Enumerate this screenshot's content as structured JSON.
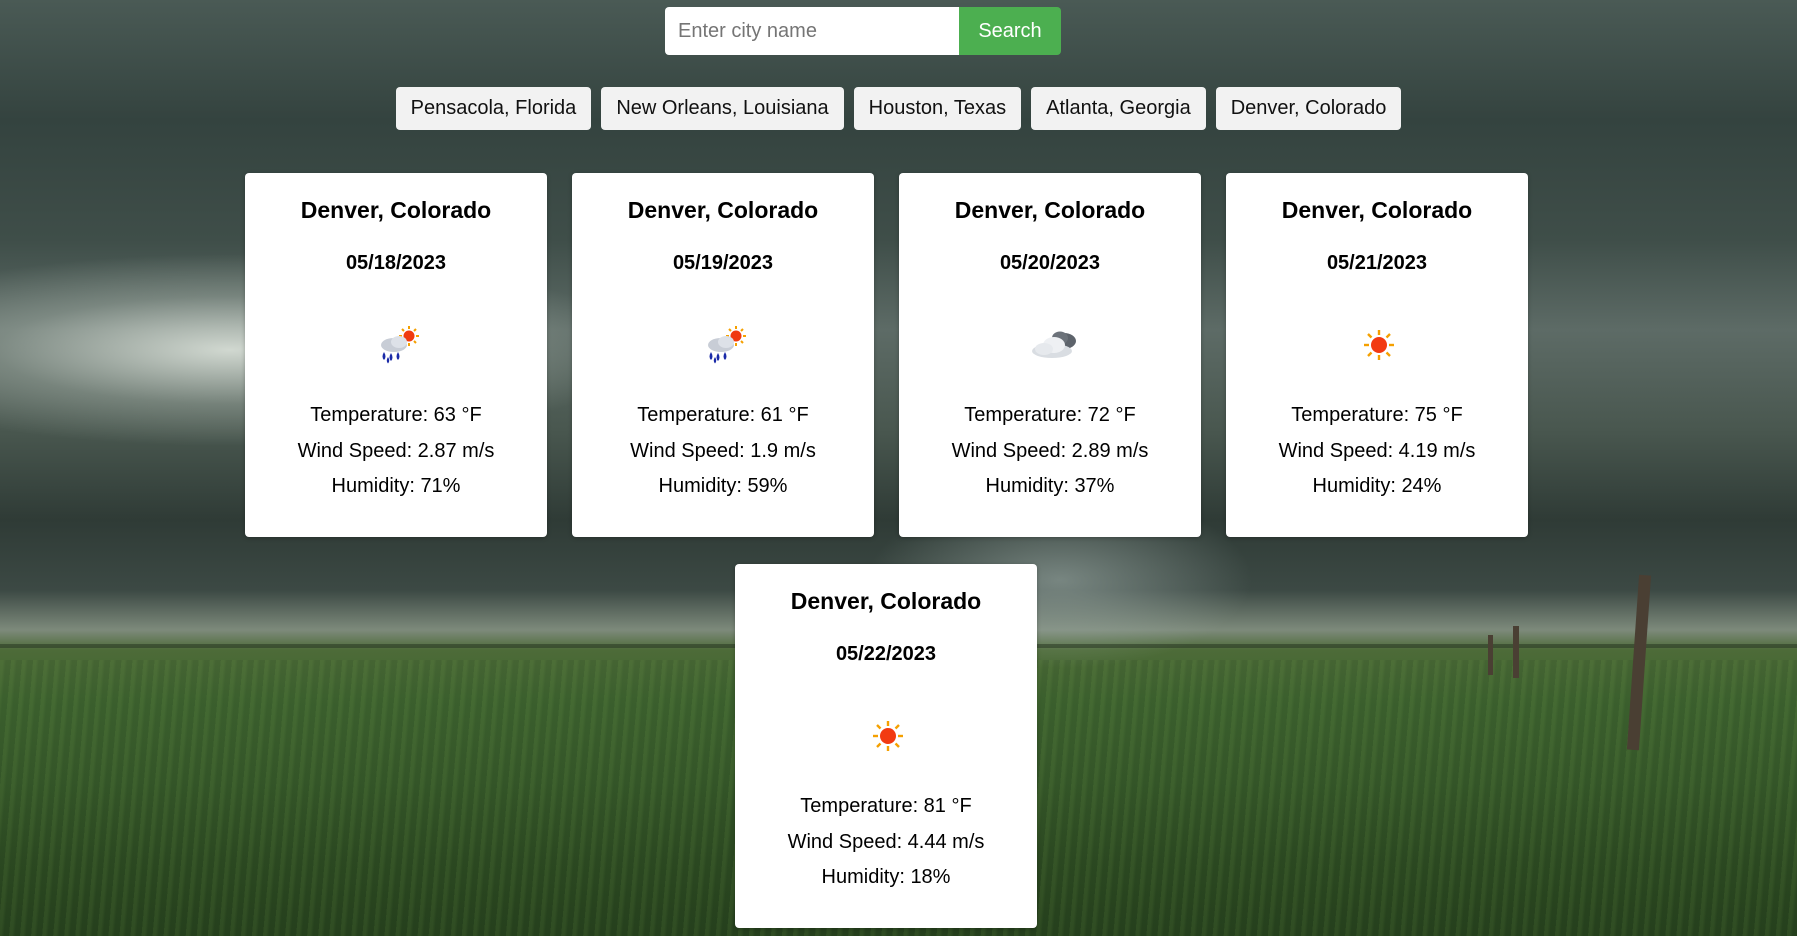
{
  "search": {
    "placeholder": "Enter city name",
    "value": "",
    "button_label": "Search",
    "button_color": "#4CAF50"
  },
  "quick_cities": [
    "Pensacola, Florida",
    "New Orleans, Louisiana",
    "Houston, Texas",
    "Atlanta, Georgia",
    "Denver, Colorado"
  ],
  "forecast": [
    {
      "city": "Denver, Colorado",
      "date": "05/18/2023",
      "icon": "rain-sun-icon",
      "temperature": "Temperature: 63 °F",
      "wind": "Wind Speed: 2.87 m/s",
      "humidity": "Humidity: 71%"
    },
    {
      "city": "Denver, Colorado",
      "date": "05/19/2023",
      "icon": "rain-sun-icon",
      "temperature": "Temperature: 61 °F",
      "wind": "Wind Speed: 1.9 m/s",
      "humidity": "Humidity: 59%"
    },
    {
      "city": "Denver, Colorado",
      "date": "05/20/2023",
      "icon": "cloudy-icon",
      "temperature": "Temperature: 72 °F",
      "wind": "Wind Speed: 2.89 m/s",
      "humidity": "Humidity: 37%"
    },
    {
      "city": "Denver, Colorado",
      "date": "05/21/2023",
      "icon": "sun-icon",
      "temperature": "Temperature: 75 °F",
      "wind": "Wind Speed: 4.19 m/s",
      "humidity": "Humidity: 24%"
    },
    {
      "city": "Denver, Colorado",
      "date": "05/22/2023",
      "icon": "sun-icon",
      "temperature": "Temperature: 81 °F",
      "wind": "Wind Speed: 4.44 m/s",
      "humidity": "Humidity: 18%"
    }
  ]
}
